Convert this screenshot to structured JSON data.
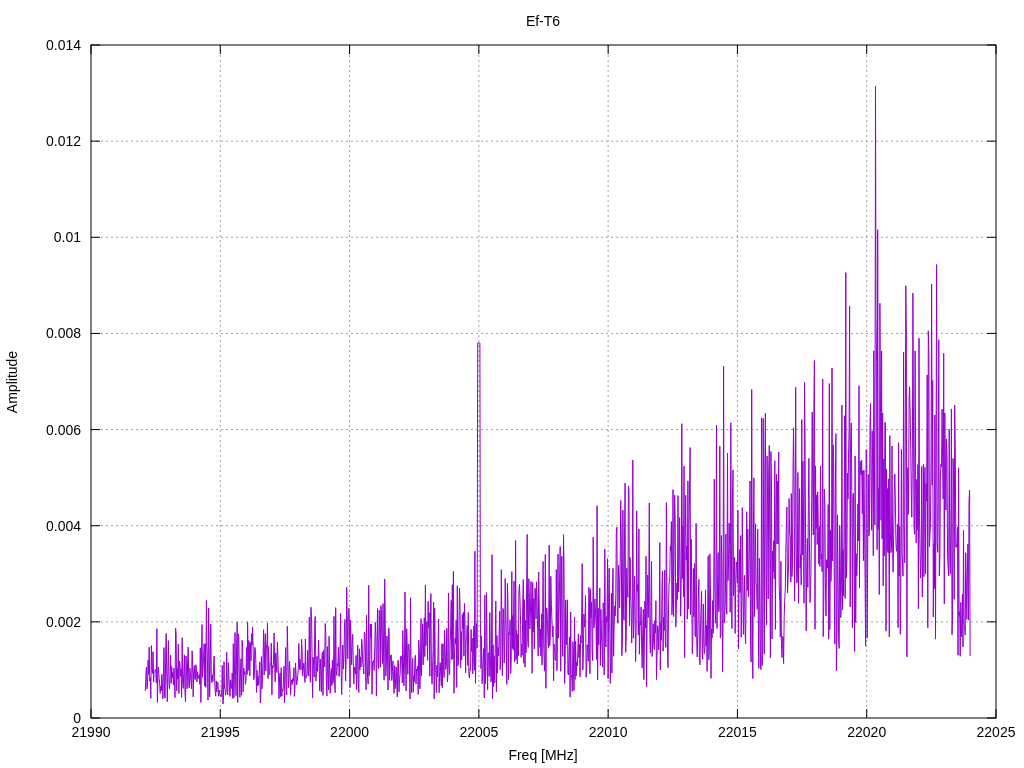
{
  "plot": {
    "title": "Ef-T6",
    "xlabel": "Freq [MHz]",
    "ylabel": "Amplitude",
    "xticks": [
      "21990",
      "21995",
      "22000",
      "22005",
      "22010",
      "22015",
      "22020",
      "22025"
    ],
    "yticks": [
      "0.014",
      "0.012",
      "0.01",
      "0.008",
      "0.006",
      "0.004",
      "0.002",
      "0"
    ]
  }
}
